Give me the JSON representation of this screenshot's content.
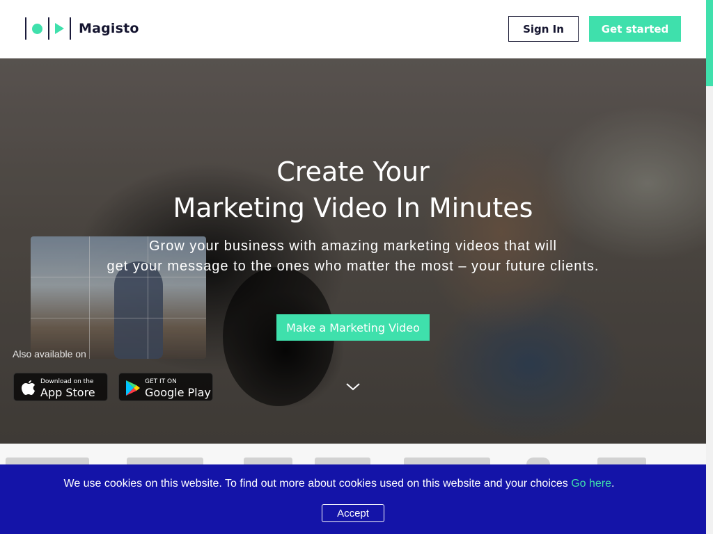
{
  "header": {
    "brand": "Magisto",
    "signin_label": "Sign In",
    "getstarted_label": "Get started"
  },
  "hero": {
    "headline_line1": "Create Your",
    "headline_line2": "Marketing Video In Minutes",
    "sub_line1": "Grow your business with amazing marketing videos that will",
    "sub_line2": "get your message to the ones who matter the most – your future clients.",
    "cta_label": "Make a Marketing Video",
    "also_available": "Also available on",
    "apple_small": "Download on the",
    "apple_big": "App Store",
    "google_small": "GET IT ON",
    "google_big": "Google Play",
    "scroll_icon": "chevron-down-icon"
  },
  "cookie": {
    "message": "We use cookies on this website. To find out more about cookies used on this website and your choices ",
    "link_text": "Go here",
    "after_link": ".",
    "accept_label": "Accept"
  },
  "colors": {
    "accent": "#3fe0ac",
    "navy": "#14142f",
    "cookie_bg": "#1414a8"
  }
}
